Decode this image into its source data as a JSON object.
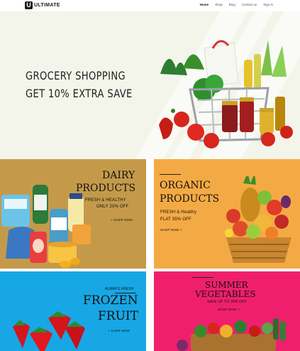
{
  "header": {
    "logo_mark": "U",
    "logo_text": "ULTIMATE",
    "nav": [
      "Home",
      "Shop",
      "Blog",
      "Contact us",
      "Sign in"
    ]
  },
  "hero": {
    "line1": "GROCERY SHOPPING",
    "line2": "GET 10% EXTRA SAVE"
  },
  "dairy": {
    "title1": "DAIRY",
    "title2": "PRODUCTS",
    "subtitle": "FRESH & HEALTHY",
    "offer": "ONLY 20% OFF",
    "link": "+ SHOP NOW"
  },
  "organic": {
    "title1": "ORGANIC",
    "title2": "PRODUCTS",
    "subtitle": "FRESH & Healthy",
    "offer": "FLAT 35% OFF",
    "link": "SHOP NOW +"
  },
  "frozen": {
    "tag": "ALWAYS FRESH",
    "title1": "FROZEN",
    "title2": "FRUIT",
    "link": "+ SHOP NOW"
  },
  "summer": {
    "title1": "SUMMER",
    "title2": "VEGETABLES",
    "offer": "SAVE UP TO 30% OFF",
    "link": "SHOP NOW +"
  }
}
